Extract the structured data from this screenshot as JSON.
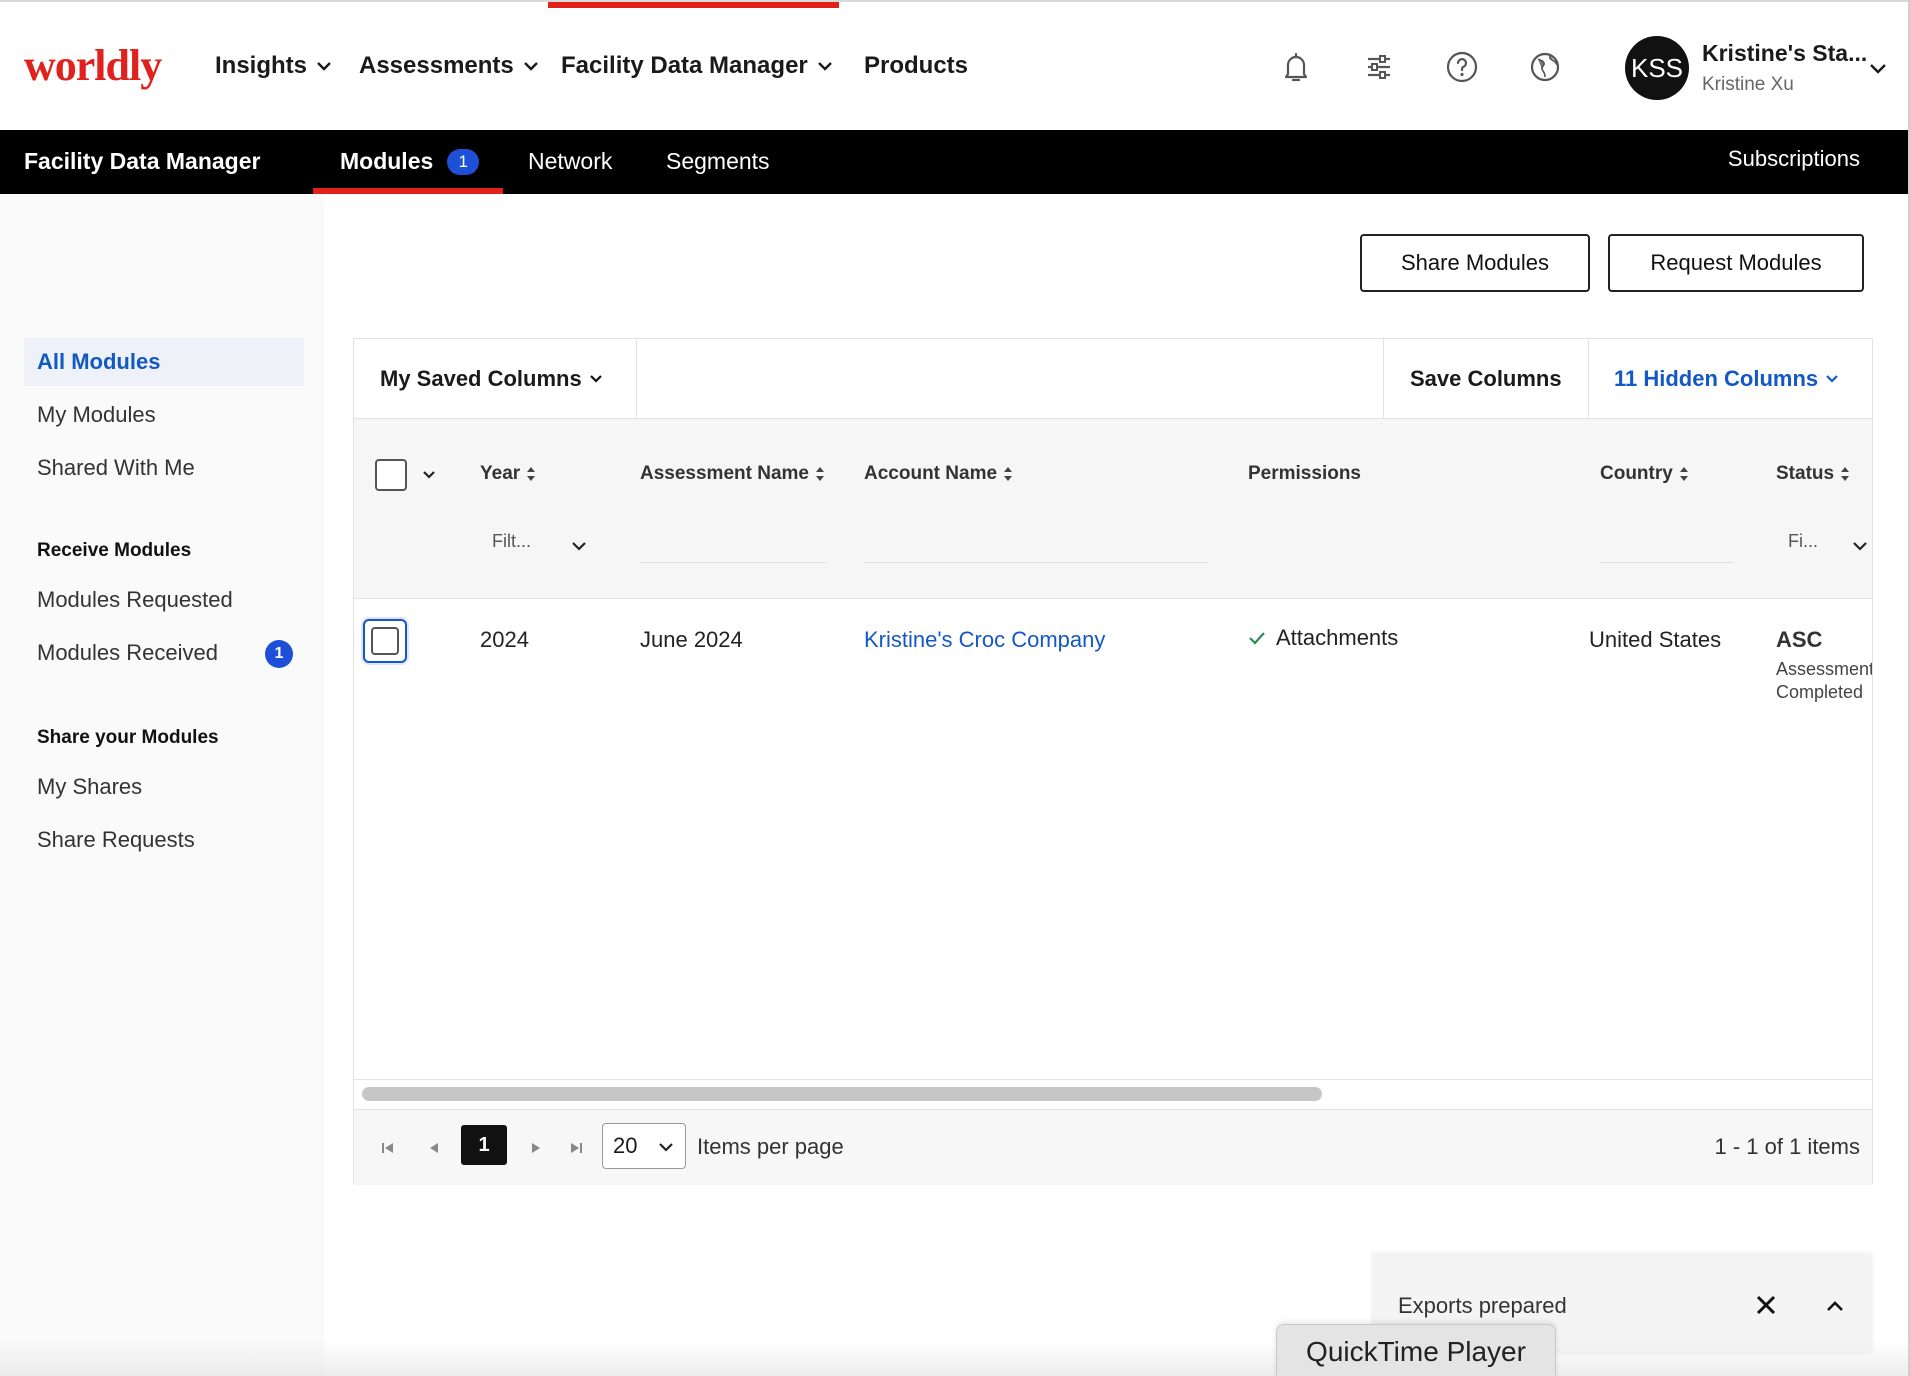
{
  "brand": {
    "logo_text": "worldly",
    "accent": "#e0211c",
    "link": "#1358c4",
    "badge": "#1d4fd7"
  },
  "topnav": {
    "items": [
      {
        "label": "Insights",
        "has_menu": true
      },
      {
        "label": "Assessments",
        "has_menu": true
      },
      {
        "label": "Facility Data Manager",
        "has_menu": true,
        "active": true
      },
      {
        "label": "Products",
        "has_menu": false
      }
    ],
    "icons": [
      "bell-icon",
      "sliders-icon",
      "help-icon",
      "globe-icon"
    ],
    "account": {
      "initials": "KSS",
      "name": "Kristine's Sta...",
      "user": "Kristine Xu"
    }
  },
  "subnav": {
    "title": "Facility Data Manager",
    "tabs": [
      {
        "label": "Modules",
        "badge": "1",
        "active": true
      },
      {
        "label": "Network"
      },
      {
        "label": "Segments"
      }
    ],
    "right_link": "Subscriptions"
  },
  "sidebar": {
    "items_top": [
      "All Modules",
      "My Modules",
      "Shared With Me"
    ],
    "active": "All Modules",
    "receive_heading": "Receive Modules",
    "receive_items": [
      {
        "label": "Modules Requested"
      },
      {
        "label": "Modules Received",
        "badge": "1"
      }
    ],
    "share_heading": "Share your Modules",
    "share_items": [
      "My Shares",
      "Share Requests"
    ]
  },
  "actions": {
    "share": "Share Modules",
    "request": "Request Modules"
  },
  "grid": {
    "toolbar": {
      "saved_columns": "My Saved Columns",
      "save_columns": "Save Columns",
      "hidden_columns": "11 Hidden Columns"
    },
    "columns": [
      "Year",
      "Assessment Name",
      "Account Name",
      "Permissions",
      "Country",
      "Status"
    ],
    "filters": {
      "year": "Filt...",
      "status": "Fi..."
    },
    "rows": [
      {
        "year": "2024",
        "assessment": "June 2024",
        "account": "Kristine's Croc Company",
        "permissions": "Attachments",
        "country": "United States",
        "status_title": "ASC",
        "status_line1": "Assessment",
        "status_line2": "Completed"
      }
    ],
    "pager": {
      "page": "1",
      "per_page": "20",
      "per_page_label": "Items per page",
      "summary": "1 - 1 of 1 items"
    }
  },
  "toast": {
    "text": "Exports prepared"
  },
  "dock": {
    "label": "QuickTime Player"
  }
}
